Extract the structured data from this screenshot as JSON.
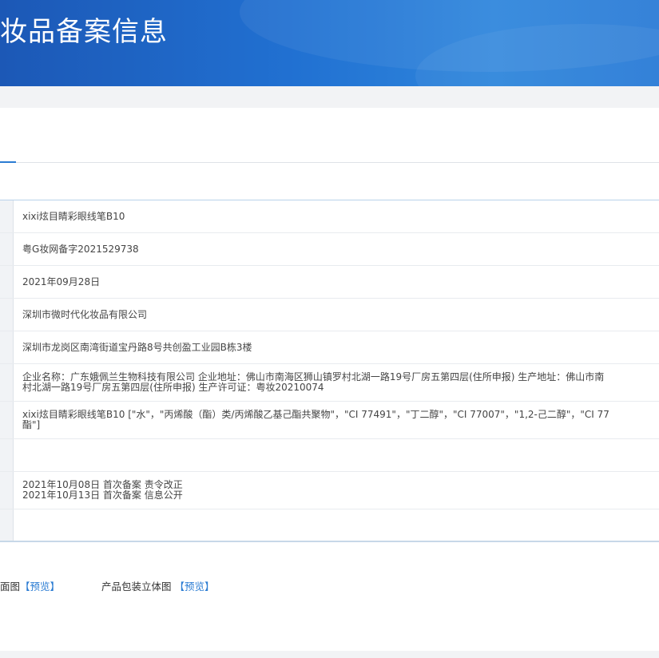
{
  "banner": {
    "title": "妆品备案信息"
  },
  "record": {
    "product_name": "xixi炫目睛彩眼线笔B10",
    "record_number": "粤G妆网备字2021529738",
    "record_date": "2021年09月28日",
    "applicant": "深圳市微时代化妆品有限公司",
    "applicant_address": "深圳市龙岗区南湾街道宝丹路8号共创盈工业园B栋3楼",
    "manufacturer_lines": [
      "企业名称：广东娥佩兰生物科技有限公司 企业地址：佛山市南海区狮山镇罗村北湖一路19号厂房五第四层(住所申报) 生产地址：佛山市南",
      "村北湖一路19号厂房五第四层(住所申报) 生产许可证：粤妆20210074"
    ],
    "ingredient_lines": [
      "xixi炫目睛彩眼线笔B10 [\"水\"，\"丙烯酸（酯）类/丙烯酸乙基己酯共聚物\"，\"CI 77491\"，\"丁二醇\"，\"CI 77007\"，\"1,2-己二醇\"，\"CI 77",
      "酯\"]"
    ],
    "empty_value": "",
    "status_lines": [
      "2021年10月08日 首次备案 责令改正",
      "2021年10月13日 首次备案 信息公开"
    ],
    "empty_value_2": ""
  },
  "previews": {
    "item1_label": "面图",
    "item1_link": "【预览】",
    "item2_label": "产品包装立体图",
    "item2_link": "【预览】"
  }
}
